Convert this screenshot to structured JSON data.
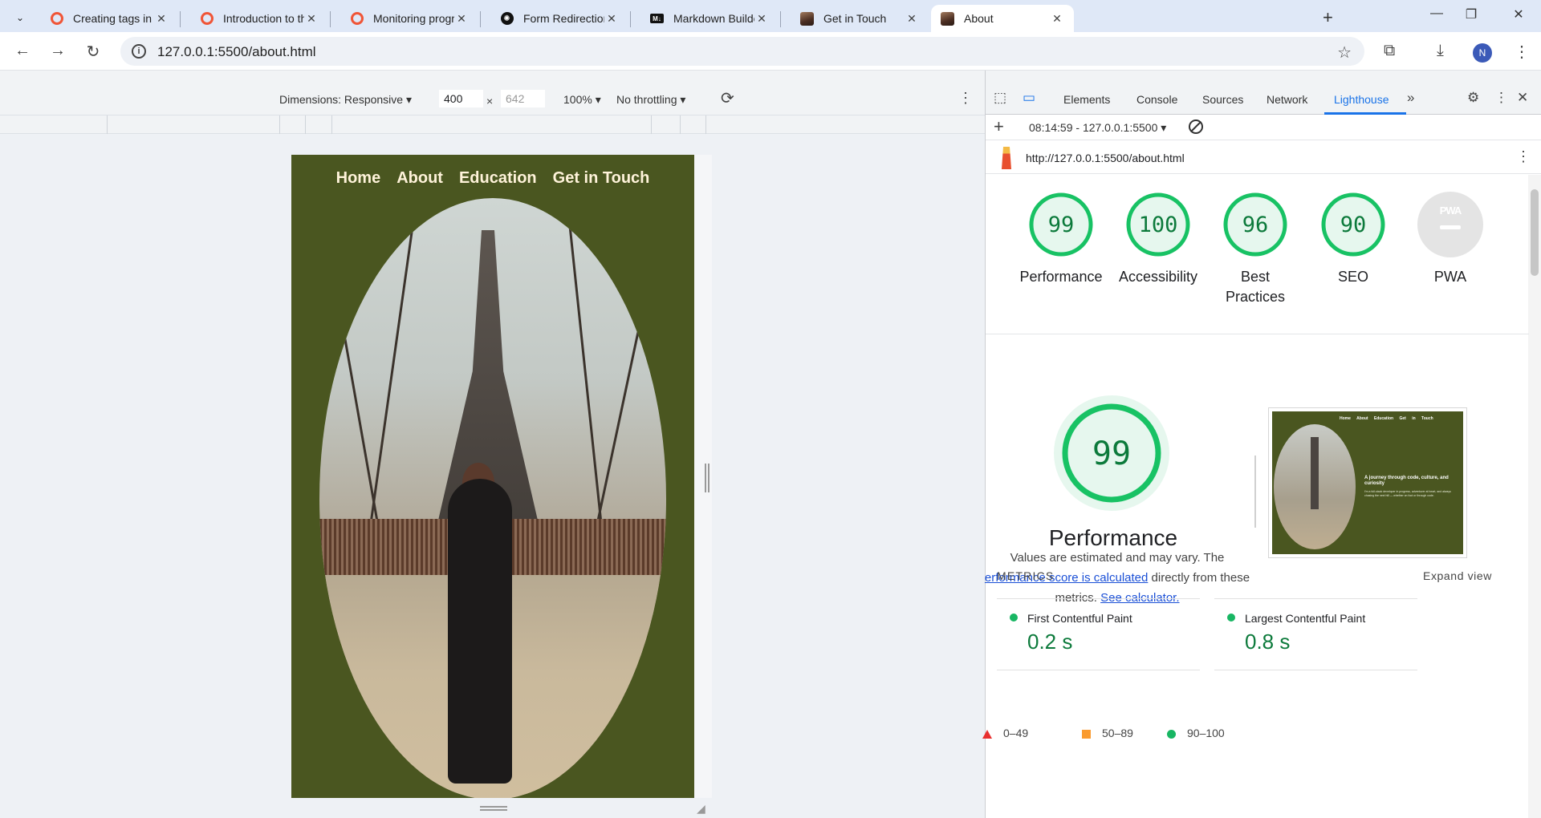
{
  "browser": {
    "tabs": [
      {
        "title": "Creating tags in GitH",
        "favicon": "ring-icon"
      },
      {
        "title": "Introduction to the B",
        "favicon": "ring-icon"
      },
      {
        "title": "Monitoring progress",
        "favicon": "ring-icon"
      },
      {
        "title": "Form Redirection Suc",
        "favicon": "openai-icon"
      },
      {
        "title": "Markdown Builder",
        "favicon": "markdown-icon"
      },
      {
        "title": "Get in Touch",
        "favicon": "profile-photo-icon"
      },
      {
        "title": "About",
        "favicon": "profile-photo-icon",
        "active": true
      }
    ],
    "url": "127.0.0.1:5500/about.html",
    "profile_initial": "N"
  },
  "device_toolbar": {
    "dimensions_label": "Dimensions: Responsive",
    "width": "400",
    "height": "642",
    "times": "×",
    "zoom": "100%",
    "throttling": "No throttling"
  },
  "site": {
    "nav": [
      "Home",
      "About",
      "Education",
      "Get in Touch"
    ],
    "bg_color": "#4a5620",
    "nav_color": "#fff3da"
  },
  "devtools": {
    "tabs": [
      "Elements",
      "Console",
      "Sources",
      "Network",
      "Lighthouse"
    ],
    "active_tab": "Lighthouse",
    "report_time": "08:14:59 - 127.0.0.1:5500",
    "report_url": "http://127.0.0.1:5500/about.html",
    "scores": [
      {
        "label": "Performance",
        "value": "99"
      },
      {
        "label": "Accessibility",
        "value": "100"
      },
      {
        "label": "Best Practices",
        "label_line1": "Best",
        "label_line2": "Practices",
        "value": "96"
      },
      {
        "label": "SEO",
        "value": "90"
      },
      {
        "label": "PWA",
        "value": "PWA"
      }
    ],
    "performance": {
      "score": "99",
      "title": "Performance",
      "desc_1": "Values are estimated and may vary. The",
      "desc_link_1": "erformance score is calculated",
      "desc_2": " directly from these",
      "desc_3": "metrics. ",
      "desc_link_2": "See calculator."
    },
    "legend": [
      {
        "range": "0–49",
        "color": "#e8302f"
      },
      {
        "range": "50–89",
        "color": "#fa9b2f"
      },
      {
        "range": "90–100",
        "color": "#18b663"
      }
    ],
    "thumbnail": {
      "nav": "Home About Education Get in Touch",
      "heading": "A journey through code, culture, and curiosity",
      "text": "I'm a full-stack developer in progress, adventurer at heart, and always chasing the next hill — whether on foot or through code."
    },
    "metrics_heading": "METRICS",
    "expand_label": "Expand view",
    "metrics": [
      {
        "name": "First Contentful Paint",
        "value": "0.2 s"
      },
      {
        "name": "Largest Contentful Paint",
        "value": "0.8 s"
      }
    ]
  }
}
